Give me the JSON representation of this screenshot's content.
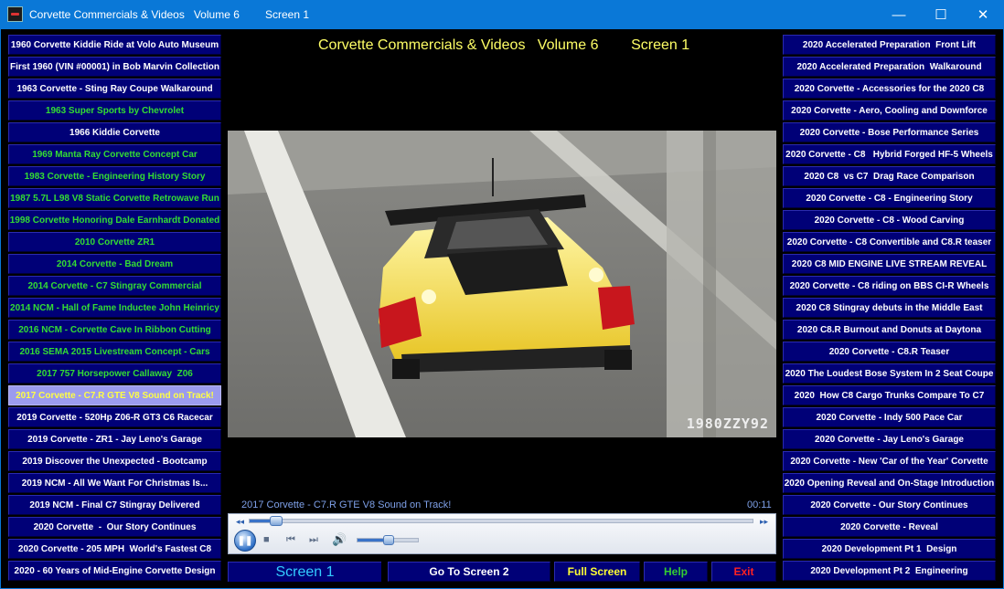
{
  "window": {
    "title": "Corvette Commercials & Videos   Volume 6",
    "screen": "Screen 1",
    "minimize_glyph": "—",
    "maximize_glyph": "☐",
    "close_glyph": "✕"
  },
  "header": {
    "title": "Corvette Commercials & Videos   Volume 6        Screen 1"
  },
  "left_list": [
    {
      "label": "1960 Corvette Kiddie Ride at Volo Auto Museum",
      "state": "normal"
    },
    {
      "label": "First 1960 (VIN #00001) in Bob Marvin Collection",
      "state": "normal"
    },
    {
      "label": "1963 Corvette - Sting Ray Coupe Walkaround",
      "state": "normal"
    },
    {
      "label": "1963 Super Sports by Chevrolet",
      "state": "visited"
    },
    {
      "label": "1966 Kiddie Corvette",
      "state": "normal"
    },
    {
      "label": "1969 Manta Ray Corvette Concept Car",
      "state": "visited"
    },
    {
      "label": "1983 Corvette - Engineering History Story",
      "state": "visited"
    },
    {
      "label": "1987 5.7L L98 V8 Static Corvette Retrowave Run",
      "state": "visited"
    },
    {
      "label": "1998 Corvette Honoring Dale Earnhardt Donated",
      "state": "visited"
    },
    {
      "label": "2010 Corvette ZR1",
      "state": "visited"
    },
    {
      "label": "2014 Corvette - Bad Dream",
      "state": "visited"
    },
    {
      "label": "2014 Corvette - C7 Stingray Commercial",
      "state": "visited"
    },
    {
      "label": "2014 NCM - Hall of Fame Inductee John Heinricy",
      "state": "visited"
    },
    {
      "label": "2016 NCM - Corvette Cave In Ribbon Cutting",
      "state": "visited"
    },
    {
      "label": "2016 SEMA 2015 Livestream Concept - Cars",
      "state": "visited"
    },
    {
      "label": "2017 757 Horsepower Callaway  Z06",
      "state": "visited"
    },
    {
      "label": "2017 Corvette - C7.R GTE V8 Sound on Track!",
      "state": "selected"
    },
    {
      "label": "2019 Corvette - 520Hp Z06-R GT3 C6 Racecar",
      "state": "normal"
    },
    {
      "label": "2019 Corvette - ZR1 - Jay Leno's Garage",
      "state": "normal"
    },
    {
      "label": "2019 Discover the Unexpected - Bootcamp",
      "state": "normal"
    },
    {
      "label": "2019 NCM - All We Want For Christmas Is...",
      "state": "normal"
    },
    {
      "label": "2019 NCM - Final C7 Stingray Delivered",
      "state": "normal"
    },
    {
      "label": "2020 Corvette  -  Our Story Continues",
      "state": "normal"
    },
    {
      "label": "2020 Corvette - 205 MPH  World's Fastest C8",
      "state": "normal"
    },
    {
      "label": "2020 - 60 Years of Mid-Engine Corvette Design",
      "state": "normal"
    }
  ],
  "right_list": [
    {
      "label": "2020 Accelerated Preparation  Front Lift"
    },
    {
      "label": "2020 Accelerated Preparation  Walkaround"
    },
    {
      "label": "2020 Corvette - Accessories for the 2020 C8"
    },
    {
      "label": "2020 Corvette - Aero, Cooling and Downforce"
    },
    {
      "label": "2020 Corvette - Bose Performance Series"
    },
    {
      "label": "2020 Corvette - C8   Hybrid Forged HF-5 Wheels"
    },
    {
      "label": "2020 C8  vs C7  Drag Race Comparison"
    },
    {
      "label": "2020 Corvette - C8 - Engineering Story"
    },
    {
      "label": "2020 Corvette - C8 - Wood Carving"
    },
    {
      "label": "2020 Corvette - C8 Convertible and C8.R teaser"
    },
    {
      "label": "2020 C8 MID ENGINE LIVE STREAM REVEAL"
    },
    {
      "label": "2020 Corvette - C8 riding on BBS CI-R Wheels"
    },
    {
      "label": "2020 C8 Stingray debuts in the Middle East"
    },
    {
      "label": "2020 C8.R Burnout and Donuts at Daytona"
    },
    {
      "label": "2020 Corvette - C8.R Teaser"
    },
    {
      "label": "2020 The Loudest Bose System In 2 Seat Coupe"
    },
    {
      "label": "2020  How C8 Cargo Trunks Compare To C7"
    },
    {
      "label": "2020 Corvette - Indy 500 Pace Car"
    },
    {
      "label": "2020 Corvette - Jay Leno's Garage"
    },
    {
      "label": "2020 Corvette - New 'Car of the Year' Corvette"
    },
    {
      "label": "2020 Opening Reveal and On-Stage Introduction"
    },
    {
      "label": "2020 Corvette - Our Story Continues"
    },
    {
      "label": "2020 Corvette - Reveal"
    },
    {
      "label": "2020 Development Pt 1  Design"
    },
    {
      "label": "2020 Development Pt 2  Engineering"
    }
  ],
  "video": {
    "watermark": "1980ZZY92",
    "now_playing": "2017 Corvette - C7.R GTE V8 Sound on Track!",
    "time": "00:11",
    "seek_fraction": 0.05,
    "volume_fraction": 0.5
  },
  "player_icons": {
    "seek_back": "◂◂",
    "seek_forward": "▸▸",
    "pause": "❚❚",
    "stop": "■",
    "prev": "⏮",
    "next": "⏭",
    "volume": "🔊"
  },
  "footer": {
    "screen_label": "Screen 1",
    "goto_label": "Go To Screen 2",
    "fullscreen_label": "Full Screen",
    "help_label": "Help",
    "exit_label": "Exit"
  },
  "colors": {
    "titlebar": "#0a78d7",
    "button_bg": "#000077",
    "selected_bg": "#9b9bee",
    "visited_text": "#33dd33",
    "title_yellow": "#ffff66"
  }
}
